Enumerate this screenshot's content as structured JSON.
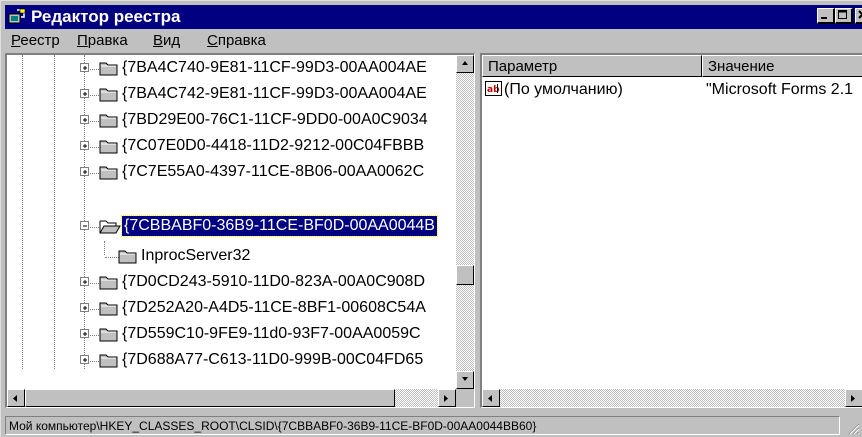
{
  "window": {
    "title": "Редактор реестра",
    "icon": "regedit-icon"
  },
  "menu": [
    {
      "label": "Реестр",
      "accel": "Р",
      "rest": "еестр"
    },
    {
      "label": "Правка",
      "accel": "П",
      "rest": "равка"
    },
    {
      "label": "Вид",
      "accel": "В",
      "rest": "ид"
    },
    {
      "label": "Справка",
      "accel": "С",
      "rest": "правка"
    }
  ],
  "tree": {
    "items": [
      {
        "label": "{7BA4C740-9E81-11CF-99D3-00AA004AE",
        "expander": "plus"
      },
      {
        "label": "{7BA4C742-9E81-11CF-99D3-00AA004AE",
        "expander": "plus"
      },
      {
        "label": "{7BD29E00-76C1-11CF-9DD0-00A0C9034",
        "expander": "plus"
      },
      {
        "label": "{7C07E0D0-4418-11D2-9212-00C04FBBB",
        "expander": "plus"
      },
      {
        "label": "{7C7E55A0-4397-11CE-8B06-00AA0062C",
        "expander": "plus"
      },
      {
        "label": "{7CBBABF0-36B9-11CE-BF0D-00AA0044B",
        "expander": "minus",
        "selected": true
      },
      {
        "label": "InprocServer32",
        "expander": "none",
        "child": true
      },
      {
        "label": "{7D0CD243-5910-11D0-823A-00A0C908D",
        "expander": "plus"
      },
      {
        "label": "{7D252A20-A4D5-11CE-8BF1-00608C54A",
        "expander": "plus"
      },
      {
        "label": "{7D559C10-9FE9-11d0-93F7-00AA0059C",
        "expander": "plus"
      },
      {
        "label": "{7D688A77-C613-11D0-999B-00C04FD65",
        "expander": "plus"
      }
    ]
  },
  "list": {
    "columns": [
      "Параметр",
      "Значение"
    ],
    "rows": [
      {
        "name": "(По умолчанию)",
        "value": "\"Microsoft Forms 2.1",
        "icon": "string-value-icon"
      }
    ]
  },
  "status": {
    "path": "Мой компьютер\\HKEY_CLASSES_ROOT\\CLSID\\{7CBBABF0-36B9-11CE-BF0D-00AA0044BB60}"
  },
  "colors": {
    "titlebar": "#000080",
    "face": "#c0c0c0",
    "selection": "#000080"
  }
}
